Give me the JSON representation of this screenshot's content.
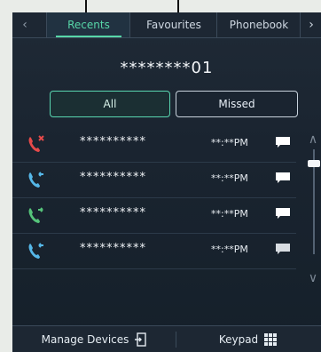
{
  "tabs": [
    {
      "label": "Recents",
      "active": true
    },
    {
      "label": "Favourites",
      "active": false
    },
    {
      "label": "Phonebook",
      "active": false
    }
  ],
  "nav": {
    "prev_icon": "chevron-left-icon",
    "next_icon": "chevron-right-icon"
  },
  "phone_number": "********01",
  "filters": {
    "all_label": "All",
    "missed_label": "Missed",
    "selected": "All"
  },
  "calls": [
    {
      "type": "missed",
      "name": "**********",
      "time": "**:**PM",
      "icon": "phone-missed-icon",
      "color": "#e64a4a"
    },
    {
      "type": "incoming",
      "name": "**********",
      "time": "**:**PM",
      "icon": "phone-incoming-icon",
      "color": "#55b7e8"
    },
    {
      "type": "outgoing",
      "name": "**********",
      "time": "**:**PM",
      "icon": "phone-outgoing-icon",
      "color": "#55c37a"
    },
    {
      "type": "incoming",
      "name": "**********",
      "time": "**:**PM",
      "icon": "phone-incoming-icon",
      "color": "#55b7e8"
    }
  ],
  "bottom": {
    "manage_devices_label": "Manage Devices",
    "keypad_label": "Keypad"
  },
  "colors": {
    "accent": "#57d6a8",
    "missed": "#e64a4a",
    "incoming": "#55b7e8",
    "outgoing": "#55c37a"
  }
}
